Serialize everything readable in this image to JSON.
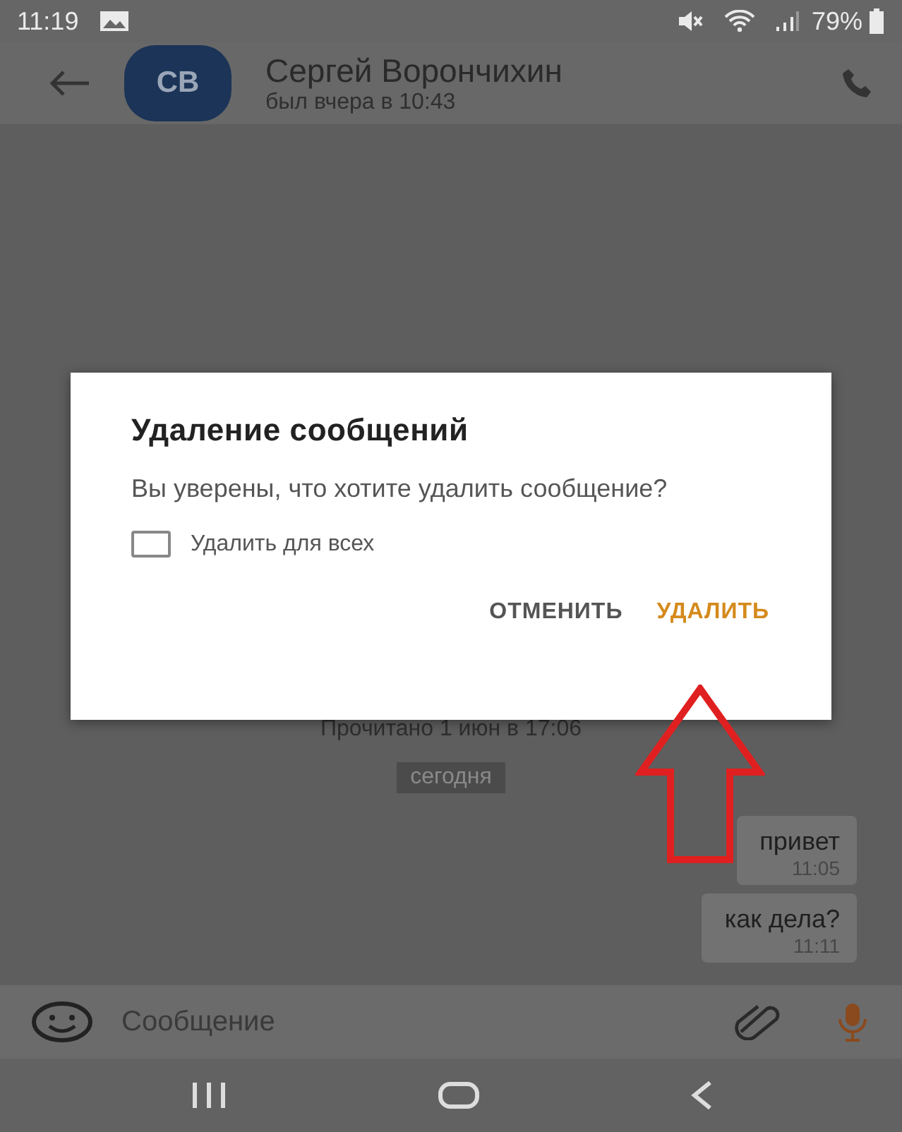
{
  "status_bar": {
    "time": "11:19",
    "battery": "79%"
  },
  "header": {
    "avatar_initials": "СВ",
    "name": "Сергей Ворончихин",
    "last_seen": "был вчера в 10:43"
  },
  "chat": {
    "read_receipt": "Прочитано 1 июн в 17:06",
    "date_chip": "сегодня",
    "messages": [
      {
        "text": "привет",
        "time": "11:05"
      },
      {
        "text": "как дела?",
        "time": "11:11"
      }
    ]
  },
  "composer": {
    "placeholder": "Сообщение"
  },
  "dialog": {
    "title": "Удаление сообщений",
    "message": "Вы уверены, что хотите удалить сообщение?",
    "checkbox": {
      "label": "Удалить для всех",
      "checked": false
    },
    "buttons": [
      {
        "label": "ОТМЕНИТЬ",
        "kind": "cancel"
      },
      {
        "label": "УДАЛИТЬ",
        "kind": "confirm"
      }
    ]
  },
  "annotation": {
    "kind": "arrow"
  }
}
